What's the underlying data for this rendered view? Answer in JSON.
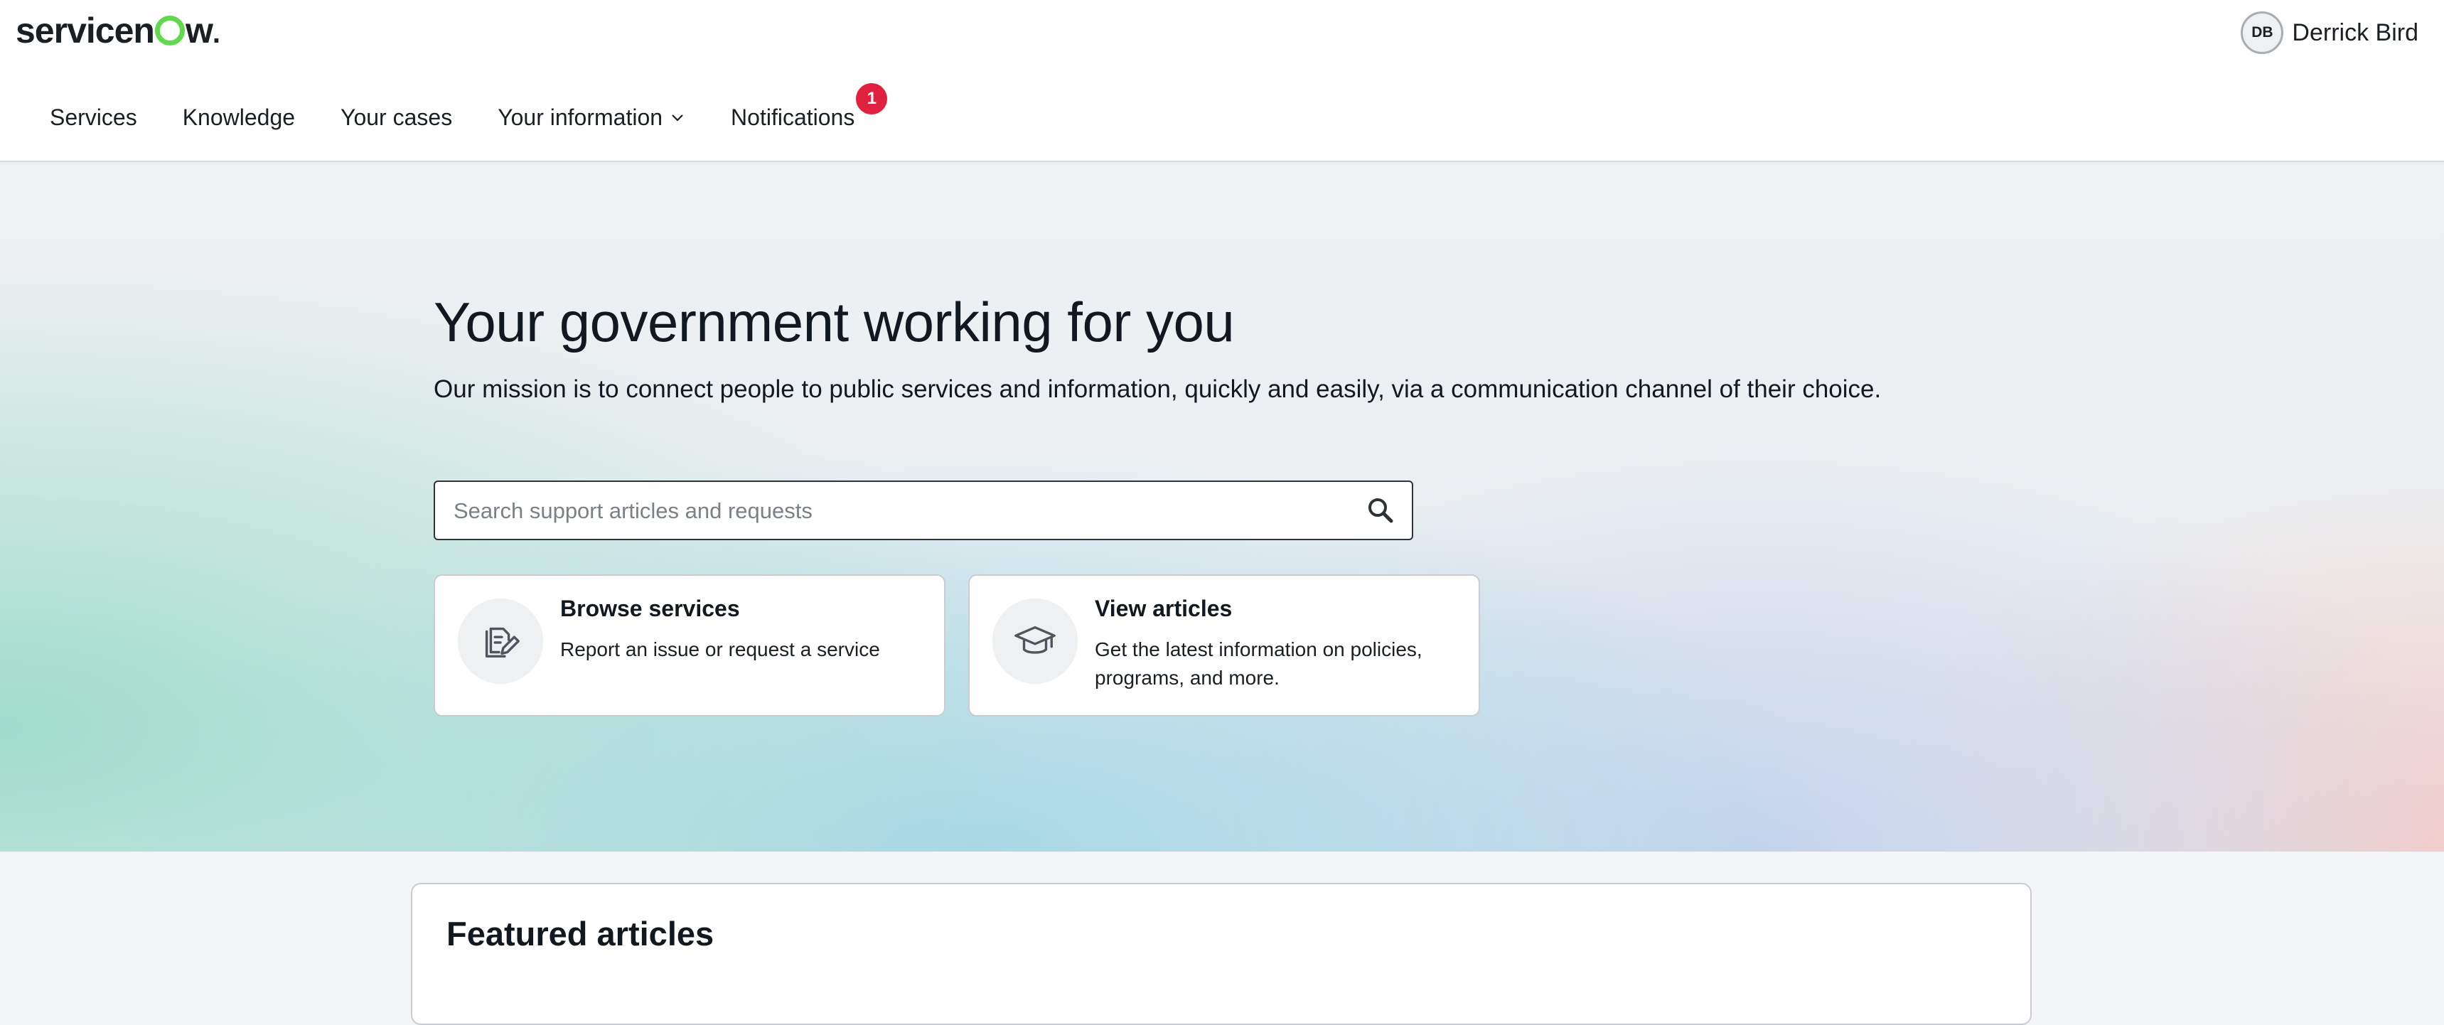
{
  "brand": {
    "logo_text_a": "servicen",
    "logo_text_b": "w",
    "logo_dot": "."
  },
  "user": {
    "initials": "DB",
    "name": "Derrick Bird"
  },
  "nav": {
    "services": "Services",
    "knowledge": "Knowledge",
    "cases": "Your cases",
    "information": "Your information",
    "notifications": "Notifications",
    "notification_count": "1"
  },
  "hero": {
    "title": "Your government working for you",
    "subtitle": "Our mission is to connect people to public services and information, quickly and easily, via a communication channel of their choice."
  },
  "search": {
    "placeholder": "Search support articles and requests",
    "value": ""
  },
  "cards": [
    {
      "title": "Browse services",
      "description": "Report an issue or request a service",
      "icon": "document-edit-icon"
    },
    {
      "title": "View articles",
      "description": "Get the latest information on policies, programs, and more.",
      "icon": "graduation-cap-icon"
    }
  ],
  "featured": {
    "title": "Featured articles"
  },
  "colors": {
    "brand_green": "#62d84e",
    "badge_red": "#e0203f",
    "text": "#111820"
  }
}
